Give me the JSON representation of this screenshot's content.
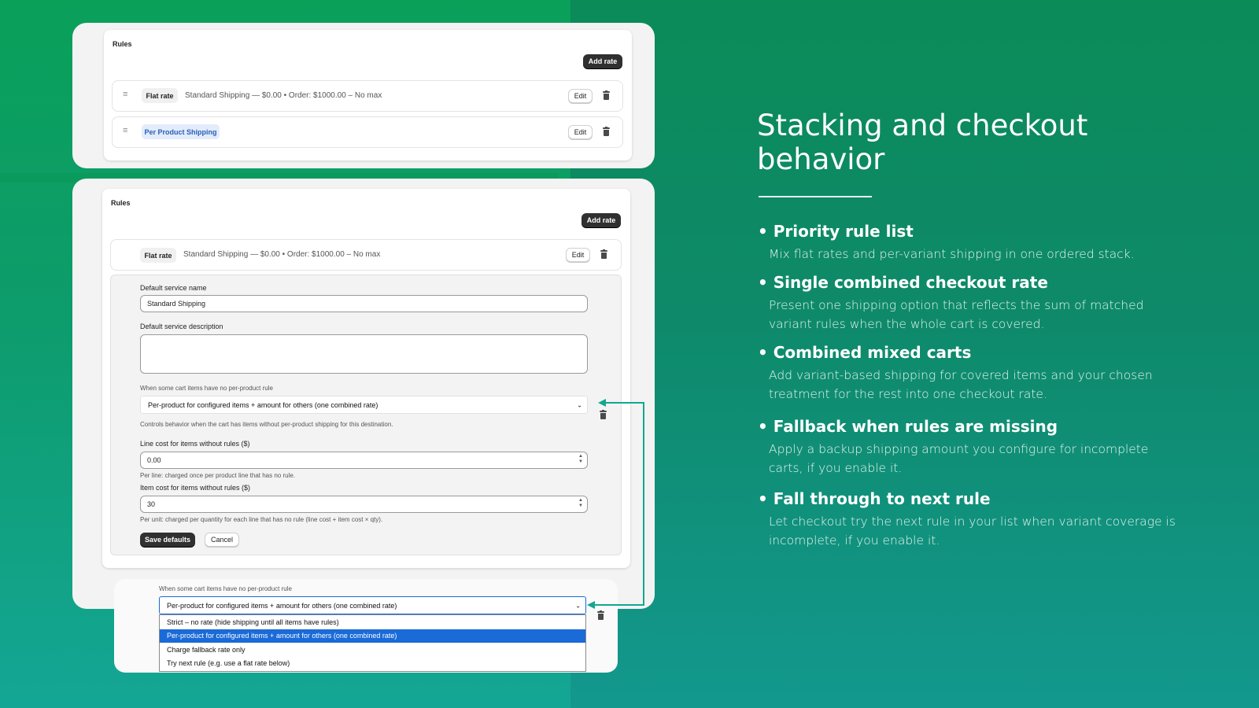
{
  "colors": {
    "accent": "#0aa05a",
    "select_highlight": "#1a6ad8",
    "connector": "#14a690"
  },
  "panel1": {
    "heading": "Rules",
    "add_rate_label": "Add rate",
    "rows": [
      {
        "tag": "Flat rate",
        "text": "Standard Shipping — $0.00 • Order: $1000.00 – No max",
        "edit_label": "Edit"
      },
      {
        "tag": "Per Product Shipping",
        "text": "",
        "edit_label": "Edit"
      }
    ]
  },
  "panel2": {
    "heading": "Rules",
    "add_rate_label": "Add rate",
    "row": {
      "tag": "Flat rate",
      "text": "Standard Shipping — $0.00 • Order: $1000.00 – No max",
      "edit_label": "Edit"
    },
    "form": {
      "service_name_label": "Default service name",
      "service_name_value": "Standard Shipping",
      "service_desc_label": "Default service description",
      "service_desc_value": "",
      "no_rule_label": "When some cart items have no per-product rule",
      "no_rule_value": "Per-product for configured items + amount for others (one combined rate)",
      "no_rule_help": "Controls behavior when the cart has items without per-product shipping for this destination.",
      "line_cost_label": "Line cost for items without rules ($)",
      "line_cost_value": "0.00",
      "line_cost_help": "Per line: charged once per product line that has no rule.",
      "item_cost_label": "Item cost for items without rules ($)",
      "item_cost_value": "30",
      "item_cost_help": "Per unit: charged per quantity for each line that has no rule (line cost + item cost × qty).",
      "save_label": "Save defaults",
      "cancel_label": "Cancel"
    }
  },
  "dropdown": {
    "label": "When some cart items have no per-product rule",
    "selected": "Per-product for configured items + amount for others (one combined rate)",
    "options": [
      "Strict – no rate (hide shipping until all items have rules)",
      "Per-product for configured items + amount for others (one combined rate)",
      "Charge fallback rate only",
      "Try next rule (e.g. use a flat rate below)"
    ]
  },
  "icons": {
    "drag": "drag-handle-icon",
    "trash": "trash-icon",
    "chevron": "chevron-down-icon"
  },
  "right": {
    "title": "Stacking and checkout behavior",
    "features": [
      {
        "title": "• Priority rule list",
        "desc": "Mix flat rates and per-variant shipping in one ordered stack."
      },
      {
        "title": "• Single combined checkout rate",
        "desc": "Present one shipping option that reflects the sum of matched variant rules when the whole cart is covered."
      },
      {
        "title": "• Combined mixed carts",
        "desc": "Add variant-based shipping for covered items and your chosen treatment for the rest into one checkout rate."
      },
      {
        "title": "• Fallback when rules are missing",
        "desc": "Apply a backup shipping amount you configure for incomplete carts, if you enable it."
      },
      {
        "title": "• Fall through to next rule",
        "desc": "Let checkout try the next rule in your list when variant coverage is incomplete, if you enable it."
      }
    ]
  }
}
